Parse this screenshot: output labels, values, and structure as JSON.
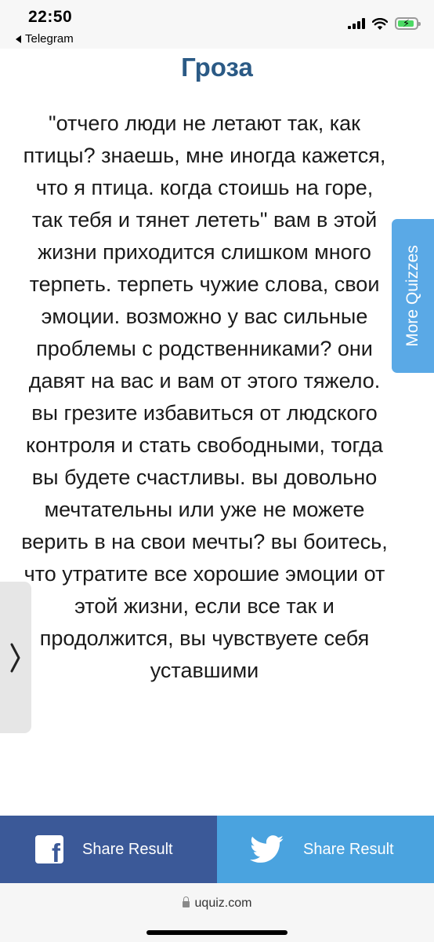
{
  "status_bar": {
    "time": "22:50",
    "back_app": "Telegram"
  },
  "page": {
    "title": "Гроза",
    "result_text": "\"отчего люди не летают так, как птицы? знаешь, мне иногда кажется, что я птица. когда стоишь на горе, так тебя и тянет лететь\"  вам в этой жизни приходится слишком много терпеть. терпеть чужие слова, свои эмоции. возможно у вас сильные проблемы с родственниками? они давят на вас и вам от этого тяжело. вы грезите избавиться от людского контроля и стать свободными, тогда вы будете счастливы. вы довольно мечтательны или уже не можете верить в на свои мечты? вы боитесь, что утратите все хорошие эмоции от этой жизни, если все так и продолжится, вы чувствуете себя уставшими"
  },
  "more_quizzes_label": "More Quizzes",
  "share": {
    "facebook_label": "Share Result",
    "twitter_label": "Share Result",
    "facebook_color": "#3b5998",
    "twitter_color": "#4aa3df"
  },
  "browser": {
    "url": "uquiz.com"
  },
  "colors": {
    "title": "#2b5a85",
    "more_tab": "#5aa9e6"
  }
}
